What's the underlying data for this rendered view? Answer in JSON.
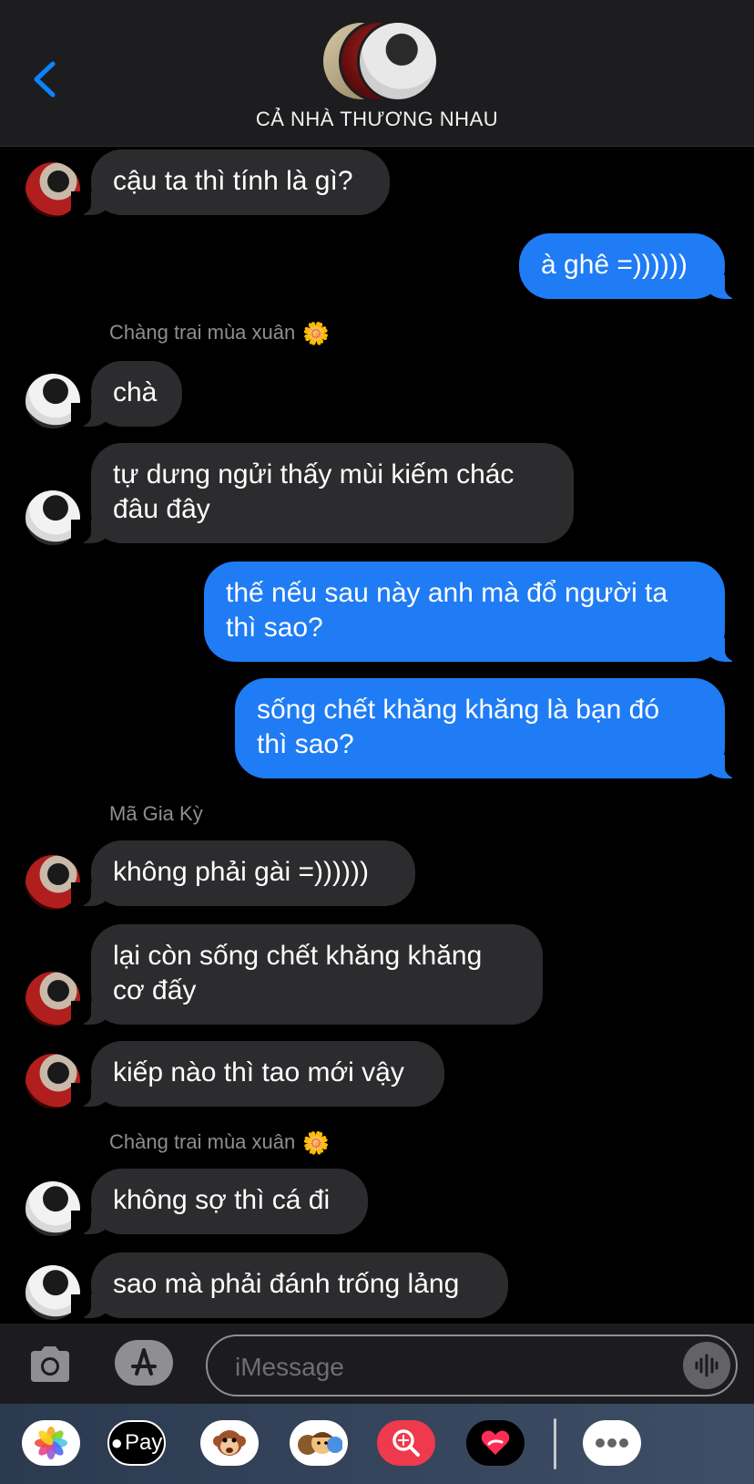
{
  "header": {
    "title": "CẢ NHÀ THƯƠNG NHAU"
  },
  "messages": {
    "m1": "cậu ta thì tính là gì?",
    "m2": "à ghê =))))))",
    "sender1": "Chàng trai mùa xuân",
    "m3": "chà",
    "m4": "tự dưng ngửi thấy mùi kiếm chác\nđâu đây",
    "m5": "thế nếu sau này anh mà đổ người ta\nthì sao?",
    "m6": "sống chết khăng khăng là bạn đó\nthì sao?",
    "sender2": "Mã Gia Kỳ",
    "m7": "không phải gài =))))))",
    "m8": "lại còn sống chết khăng khăng\ncơ đấy",
    "m9": "kiếp nào thì tao mới vậy",
    "sender3": "Chàng trai mùa xuân",
    "m10": "không sợ thì cá đi",
    "m11": "sao mà phải đánh trống lảng"
  },
  "input": {
    "placeholder": "iMessage"
  },
  "drawer": {
    "applepay_label": "Pay"
  },
  "icons": [
    "chevron-left-icon",
    "camera-icon",
    "app-store-icon",
    "microphone-icon",
    "photos-icon",
    "apple-pay-icon",
    "monkey-icon",
    "memoji-icon",
    "search-images-icon",
    "digital-touch-icon",
    "more-icon",
    "flower-icon"
  ],
  "colors": {
    "outgoing": "#1f7cf5",
    "incoming": "#2c2c2e",
    "accent": "#0a84ff"
  }
}
